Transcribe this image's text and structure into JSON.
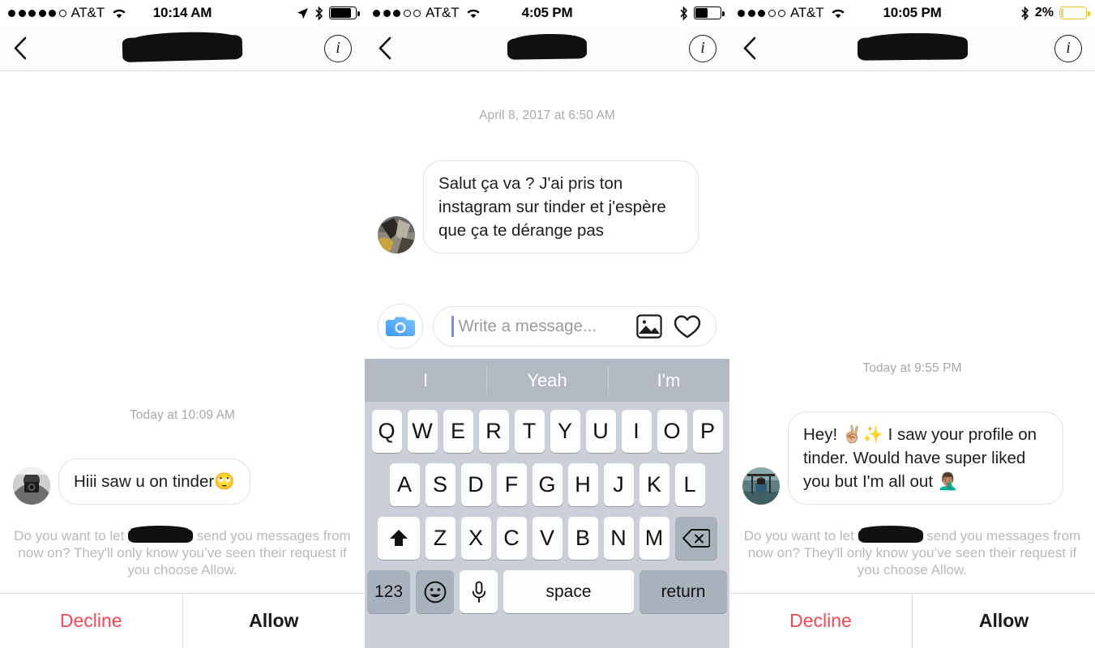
{
  "panels": [
    {
      "status": {
        "carrier": "AT&T",
        "time": "10:14 AM",
        "signal_filled": 5,
        "signal_total": 6,
        "battery_percent_label": "",
        "battery_level": 0.82,
        "battery_low_power": false,
        "location_icon": true,
        "bluetooth_icon": true,
        "wifi_icon": true
      },
      "nav": {
        "title_redacted": true,
        "back_icon": "chevron-left-icon",
        "info_icon": "info-circle-icon"
      },
      "timestamp": "Today at 10:09 AM",
      "message": {
        "text": "Hiii saw u on tinder🙄",
        "avatar": "sender-avatar"
      },
      "request": {
        "before": "Do you want to let ",
        "after": " send you messages from now on? They'll only know you’ve seen their request if you choose Allow.",
        "decline_label": "Decline",
        "allow_label": "Allow"
      }
    },
    {
      "status": {
        "carrier": "AT&T",
        "time": "4:05 PM",
        "signal_filled": 3,
        "signal_total": 5,
        "battery_percent_label": "",
        "battery_level": 0.5,
        "battery_low_power": false,
        "location_icon": false,
        "bluetooth_icon": true,
        "wifi_icon": true
      },
      "nav": {
        "title_redacted": true,
        "back_icon": "chevron-left-icon",
        "info_icon": "info-circle-icon"
      },
      "timestamp": "April 8, 2017 at 6:50 AM",
      "message": {
        "text": "Salut ça va ? J'ai pris ton instagram sur tinder et j'espère que ça te dérange pas",
        "avatar": "sender-avatar"
      },
      "composer": {
        "placeholder": "Write a message...",
        "camera_icon": "camera-icon",
        "photo_icon": "photo-library-icon",
        "heart_icon": "heart-icon"
      },
      "keyboard": {
        "predictions": [
          "I",
          "Yeah",
          "I'm"
        ],
        "row1": [
          "Q",
          "W",
          "E",
          "R",
          "T",
          "Y",
          "U",
          "I",
          "O",
          "P"
        ],
        "row2": [
          "A",
          "S",
          "D",
          "F",
          "G",
          "H",
          "J",
          "K",
          "L"
        ],
        "row3": [
          "Z",
          "X",
          "C",
          "V",
          "B",
          "N",
          "M"
        ],
        "shift_icon": "shift-arrow-icon",
        "delete_icon": "backspace-icon",
        "numeric_label": "123",
        "emoji_icon": "smiley-face-icon",
        "mic_icon": "microphone-icon",
        "space_label": "space",
        "return_label": "return"
      }
    },
    {
      "status": {
        "carrier": "AT&T",
        "time": "10:05 PM",
        "signal_filled": 3,
        "signal_total": 5,
        "battery_percent_label": "2%",
        "battery_level": 0.08,
        "battery_low_power": true,
        "location_icon": false,
        "bluetooth_icon": true,
        "wifi_icon": true
      },
      "nav": {
        "title_redacted": true,
        "back_icon": "chevron-left-icon",
        "info_icon": "info-circle-icon"
      },
      "timestamp": "Today at 9:55 PM",
      "message": {
        "text": "Hey! ✌🏼✨ I saw your profile on tinder. Would have super liked you but I'm all out 🤦🏽‍♂️",
        "avatar": "sender-avatar"
      },
      "request": {
        "before": "Do you want to let ",
        "after": " send you messages from now on? They'll only know you’ve seen their request if you choose Allow.",
        "decline_label": "Decline",
        "allow_label": "Allow"
      }
    }
  ],
  "colors": {
    "decline": "#ED4956",
    "bubble_border": "#e2e2e2",
    "timestamp_gray": "#a8a8a8",
    "request_gray": "#b9b9b9",
    "keyboard_bg": "#cbd0d8",
    "predict_bg": "#b2b9c3",
    "key_dark": "#a9b1bd",
    "battery_yellow": "#f2d64b"
  }
}
